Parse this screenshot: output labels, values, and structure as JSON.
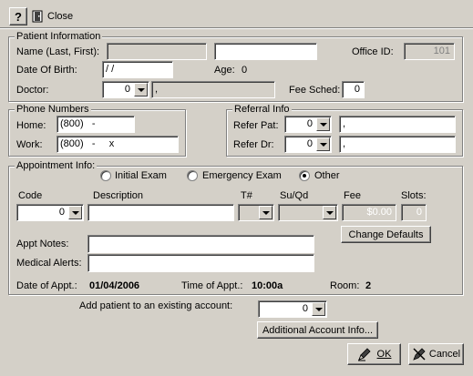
{
  "toolbar": {
    "help_label": "?",
    "close_label": "Close"
  },
  "patient_info": {
    "title": "Patient Information",
    "name_label": "Name (Last, First):",
    "office_id_label": "Office ID:",
    "office_id_value": "101",
    "dob_label": "Date Of Birth:",
    "dob_value": " / /",
    "age_label": "Age:",
    "age_value": "0",
    "doctor_label": "Doctor:",
    "doctor_value": "0",
    "doctor_name": ",",
    "fee_sched_label": "Fee Sched:",
    "fee_sched_value": "0"
  },
  "phone": {
    "title": "Phone Numbers",
    "home_label": "Home:",
    "home_value": "(800)   -",
    "work_label": "Work:",
    "work_value": "(800)   -     x"
  },
  "referral": {
    "title": "Referral Info",
    "refer_pat_label": "Refer Pat:",
    "refer_pat_value": "0",
    "refer_pat_name": ",",
    "refer_dr_label": "Refer Dr:",
    "refer_dr_value": "0",
    "refer_dr_name": ","
  },
  "appointment": {
    "title": "Appointment Info:",
    "radio_initial": "Initial Exam",
    "radio_emergency": "Emergency Exam",
    "radio_other": "Other",
    "selected_type": "Other",
    "col_code": "Code",
    "col_description": "Description",
    "col_tnum": "T#",
    "col_suqd": "Su/Qd",
    "col_fee": "Fee",
    "col_slots": "Slots:",
    "code_value": "0",
    "fee_value": "$0.00",
    "slots_value": "0",
    "change_defaults_label": "Change Defaults",
    "appt_notes_label": "Appt Notes:",
    "medical_alerts_label": "Medical Alerts:",
    "date_label": "Date of Appt.:",
    "date_value": "01/04/2006",
    "time_label": "Time of Appt.:",
    "time_value": "10:00a",
    "room_label": "Room:",
    "room_value": "2"
  },
  "account": {
    "add_label": "Add patient to an existing account:",
    "account_value": "0",
    "additional_label": "Additional Account Info..."
  },
  "footer": {
    "ok_label": "OK",
    "cancel_label": "Cancel"
  }
}
